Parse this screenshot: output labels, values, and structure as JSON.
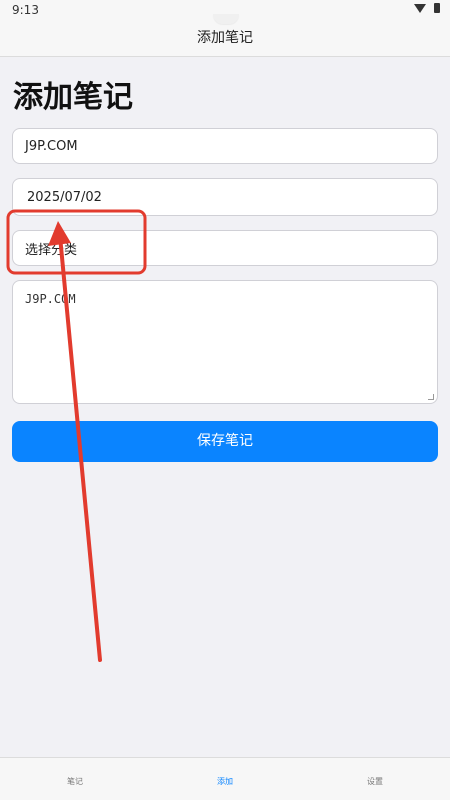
{
  "status_bar": {
    "time": "9:13"
  },
  "title_bar": {
    "title": "添加笔记"
  },
  "page": {
    "heading": "添加笔记"
  },
  "form": {
    "title_value": "J9P.COM",
    "date_value": "2025/07/02",
    "category_value": "选择分类",
    "content_value": "J9P.COM",
    "save_label": "保存笔记"
  },
  "tabs": [
    {
      "label": "笔记"
    },
    {
      "label": "添加"
    },
    {
      "label": "设置"
    }
  ],
  "colors": {
    "accent": "#0a84ff",
    "annotation": "#e23b2e"
  }
}
